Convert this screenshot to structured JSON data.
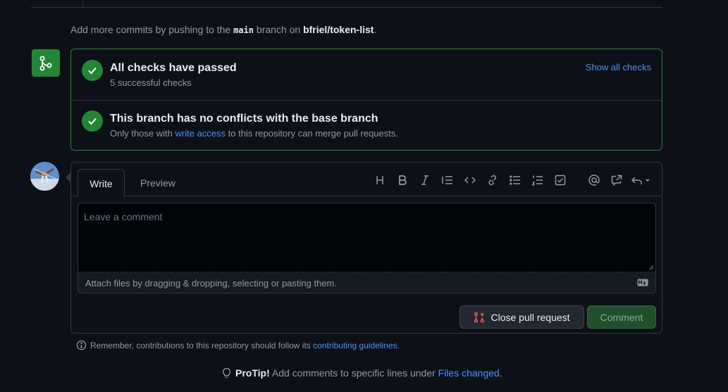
{
  "hint": {
    "prefix": "Add more commits by pushing to the",
    "branch": "main",
    "middle": "branch on",
    "repo": "bfriel/token-list",
    "suffix": "."
  },
  "checks": {
    "title": "All checks have passed",
    "subtitle": "5 successful checks",
    "show_all": "Show all checks"
  },
  "conflicts": {
    "title": "This branch has no conflicts with the base branch",
    "sub_prefix": "Only those with",
    "sub_link": "write access",
    "sub_suffix": "to this repository can merge pull requests."
  },
  "editor": {
    "tabs": [
      "Write",
      "Preview"
    ],
    "placeholder": "Leave a comment",
    "attach_text": "Attach files by dragging & dropping, selecting or pasting them.",
    "toolbar_icons": [
      "heading-icon",
      "bold-icon",
      "italic-icon",
      "quote-icon",
      "code-icon",
      "link-icon",
      "unordered-list-icon",
      "ordered-list-icon",
      "task-list-icon",
      "mention-icon",
      "cross-reference-icon",
      "saved-replies-icon"
    ]
  },
  "buttons": {
    "close_pr": "Close pull request",
    "comment": "Comment"
  },
  "footer": {
    "remember_prefix": "Remember, contributions to this repository should follow its",
    "remember_link": "contributing guidelines",
    "remember_suffix": ".",
    "protip_label": "ProTip!",
    "protip_prefix": "Add comments to specific lines under",
    "protip_link": "Files changed",
    "protip_suffix": "."
  },
  "colors": {
    "background": "#0d1117",
    "success": "#238636",
    "link": "#4493f8",
    "danger": "#f85149"
  }
}
